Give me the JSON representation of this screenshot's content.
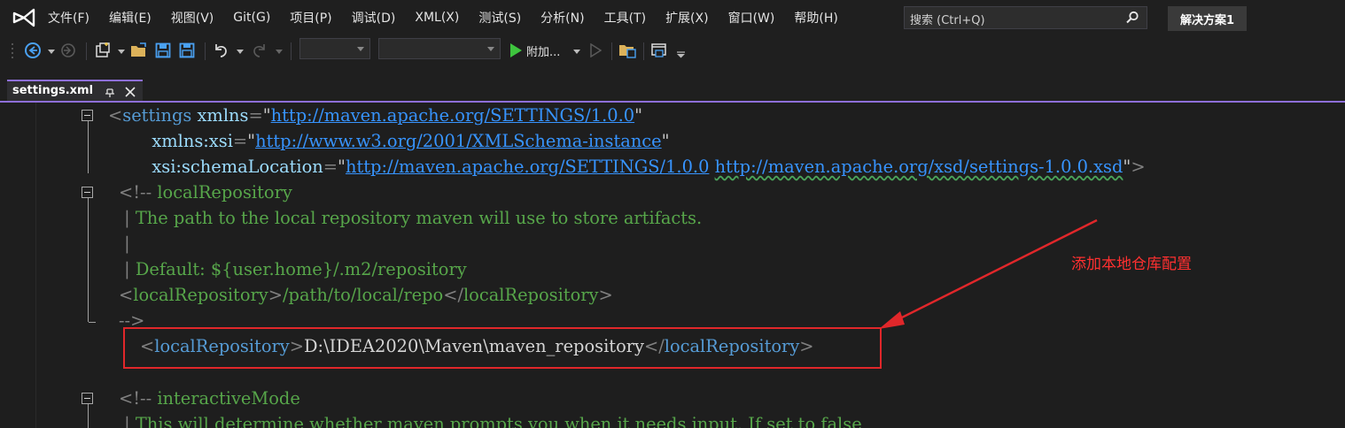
{
  "menubar": {
    "items": [
      "文件(F)",
      "编辑(E)",
      "视图(V)",
      "Git(G)",
      "项目(P)",
      "调试(D)",
      "XML(X)",
      "测试(S)",
      "分析(N)",
      "工具(T)",
      "扩展(X)",
      "窗口(W)",
      "帮助(H)"
    ],
    "search_placeholder": "搜索 (Ctrl+Q)",
    "solution_label": "解决方案1"
  },
  "toolbar": {
    "attach_label": "附加...",
    "icons": [
      "back-icon",
      "forward-icon",
      "new-item-icon",
      "open-folder-icon",
      "save-icon",
      "save-all-icon",
      "undo-icon",
      "redo-icon",
      "start-icon",
      "start-without-debug-icon",
      "open-folder-icon-2",
      "window-layout-icon"
    ]
  },
  "tab": {
    "title": "settings.xml",
    "accent_color": "#8e6fd8"
  },
  "editor": {
    "lines": [
      {
        "parts": [
          [
            "br",
            "<"
          ],
          [
            "tag",
            "settings"
          ],
          [
            "plain",
            " "
          ],
          [
            "attr",
            "xmlns"
          ],
          [
            "br",
            "="
          ],
          [
            "strq",
            "\""
          ],
          [
            "str",
            "http://maven.apache.org/SETTINGS/1.0.0"
          ],
          [
            "strq",
            "\""
          ]
        ]
      },
      {
        "parts": [
          [
            "plain",
            "        "
          ],
          [
            "attr",
            "xmlns:xsi"
          ],
          [
            "br",
            "="
          ],
          [
            "strq",
            "\""
          ],
          [
            "str",
            "http://www.w3.org/2001/XMLSchema-instance"
          ],
          [
            "strq",
            "\""
          ]
        ]
      },
      {
        "parts": [
          [
            "plain",
            "        "
          ],
          [
            "attr",
            "xsi:schemaLocation"
          ],
          [
            "br",
            "="
          ],
          [
            "strq",
            "\""
          ],
          [
            "str",
            "http://maven.apache.org/SETTINGS/1.0.0"
          ],
          [
            "plain",
            " "
          ],
          [
            "strsq",
            "http://maven.apache.org/xsd/settings-1.0.0.xsd"
          ],
          [
            "strq",
            "\""
          ],
          [
            "br",
            ">"
          ]
        ]
      },
      {
        "parts": [
          [
            "br",
            "<!--"
          ],
          [
            "cmt",
            " localRepository"
          ]
        ]
      },
      {
        "parts": [
          [
            "br",
            " | "
          ],
          [
            "cmt",
            "The path to the local repository maven will use to store artifacts."
          ]
        ]
      },
      {
        "parts": [
          [
            "br",
            " |"
          ]
        ]
      },
      {
        "parts": [
          [
            "br",
            " | "
          ],
          [
            "cmt",
            "Default: ${user.home}/.m2/repository"
          ]
        ]
      },
      {
        "parts": [
          [
            "br",
            "<"
          ],
          [
            "cmt",
            "localRepository"
          ],
          [
            "br",
            ">"
          ],
          [
            "cmt",
            "/path/to/local/repo"
          ],
          [
            "br",
            "</"
          ],
          [
            "cmt",
            "localRepository"
          ],
          [
            "br",
            ">"
          ]
        ]
      },
      {
        "parts": [
          [
            "br",
            "-->"
          ]
        ]
      },
      {
        "parts": [
          [
            "br",
            "<"
          ],
          [
            "tag",
            "localRepository"
          ],
          [
            "br",
            ">"
          ],
          [
            "plain",
            "D:\\IDEA2020\\Maven\\maven_repository"
          ],
          [
            "br",
            "</"
          ],
          [
            "tag",
            "localRepository"
          ],
          [
            "br",
            ">"
          ]
        ]
      },
      {
        "parts": []
      },
      {
        "parts": [
          [
            "br",
            "<!--"
          ],
          [
            "cmt",
            " interactiveMode"
          ]
        ]
      },
      {
        "parts": [
          [
            "br",
            " | "
          ],
          [
            "cmt",
            "This will determine whether maven prompts you when it needs input. If set to false,"
          ]
        ]
      }
    ]
  },
  "annotation": {
    "text": "添加本地仓库配置",
    "color": "#ff3030"
  }
}
